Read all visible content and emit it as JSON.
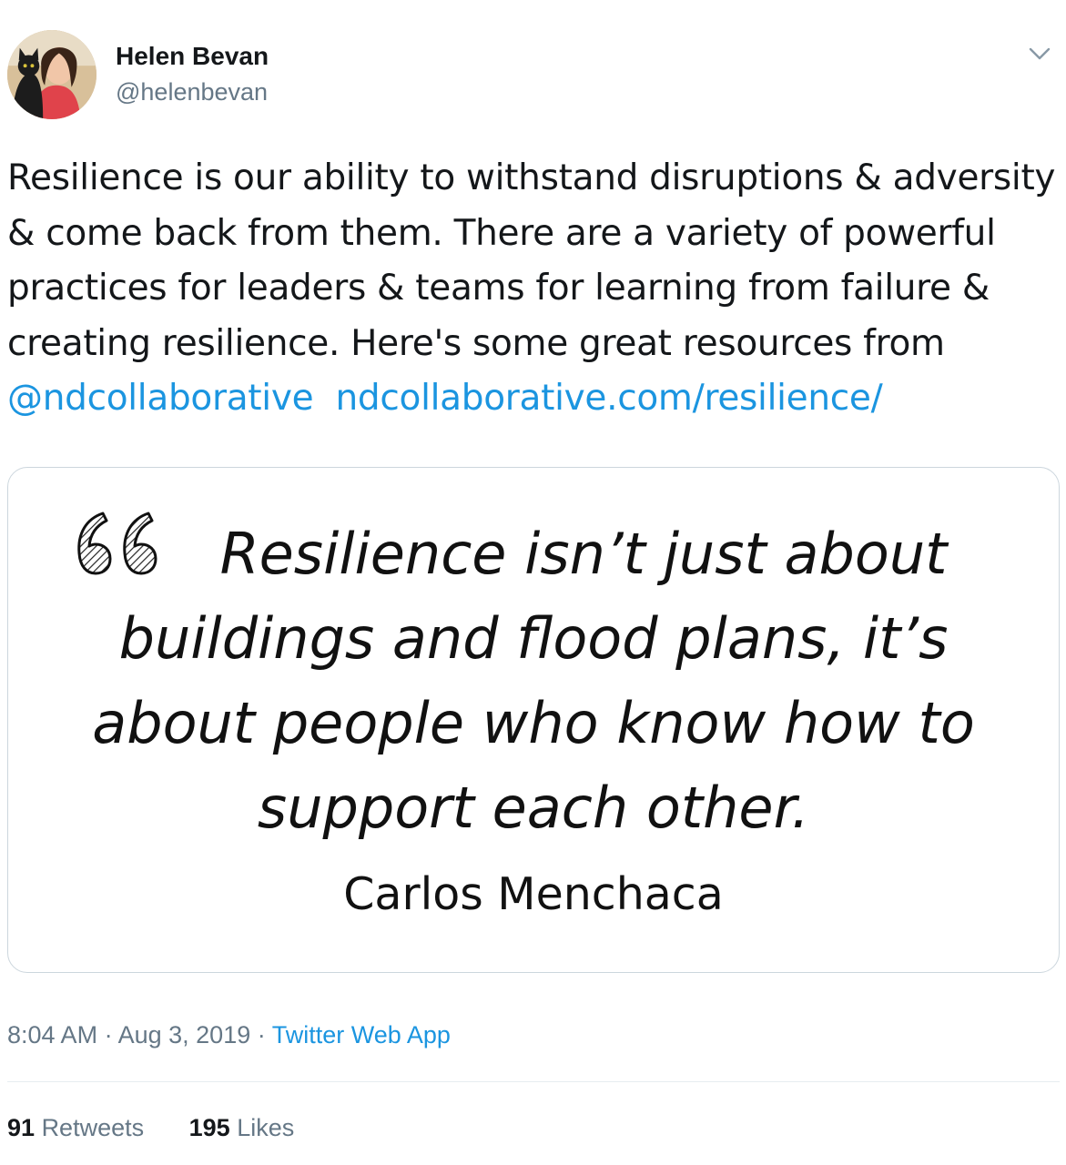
{
  "author": {
    "name": "Helen Bevan",
    "handle": "@helenbevan"
  },
  "tweet": {
    "text_plain": "Resilience is our ability to withstand disruptions & adversity & come back from them. There are a variety of powerful practices for leaders & teams for learning from failure & creating resilience. Here's some great resources from",
    "mention": "@ndcollaborative",
    "link": "ndcollaborative.com/resilience/"
  },
  "media": {
    "quote_lines": [
      "Resilience isn’t just about",
      "buildings and flood plans, it’s",
      "about people who know how to",
      "support each other."
    ],
    "quote_author": "Carlos Menchaca"
  },
  "meta": {
    "time": "8:04 AM",
    "separator": "·",
    "date": "Aug 3, 2019",
    "source": "Twitter Web App"
  },
  "stats": {
    "retweets_count": "91",
    "retweets_label": "Retweets",
    "likes_count": "195",
    "likes_label": "Likes"
  },
  "colors": {
    "link": "#1b95e0",
    "secondary_text": "#657786",
    "primary_text": "#14171a",
    "border": "#ccd6dd"
  },
  "icons": {
    "menu": "chevron-down-icon",
    "quote": "quote-mark-icon"
  }
}
